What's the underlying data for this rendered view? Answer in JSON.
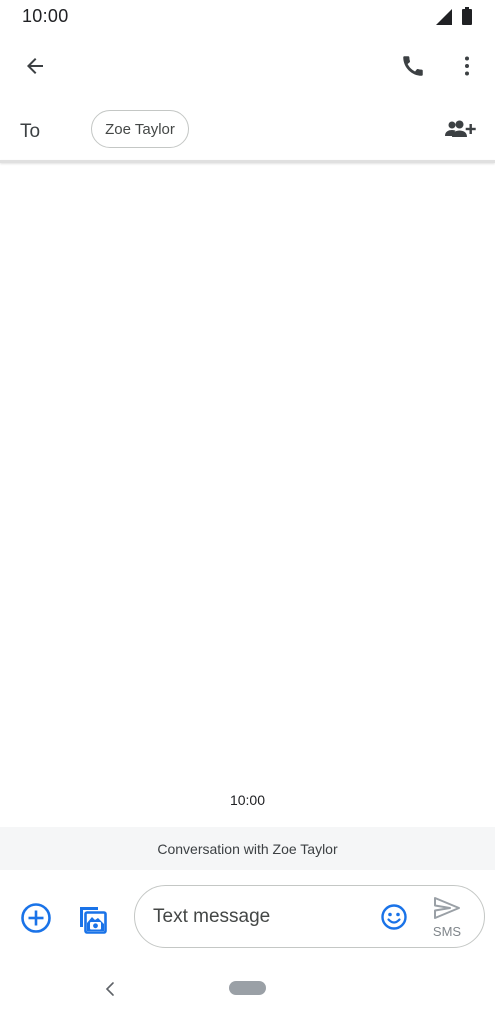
{
  "status_bar": {
    "time": "10:00",
    "icons": [
      "signal-icon",
      "battery-icon"
    ]
  },
  "app_bar": {
    "icons": [
      "back-arrow-icon",
      "phone-icon",
      "more-vert-icon"
    ]
  },
  "recipients": {
    "to_label": "To",
    "chips": [
      "Zoe Taylor"
    ],
    "add_icon": "add-person-icon"
  },
  "conversation": {
    "timestamp": "10:00",
    "banner": "Conversation with Zoe Taylor"
  },
  "compose": {
    "placeholder": "Text message",
    "value": "",
    "send_label": "SMS",
    "icons": [
      "add-circle-icon",
      "gallery-icon",
      "emoji-icon",
      "send-icon"
    ]
  },
  "nav": {
    "icons": [
      "nav-back-icon",
      "home-pill-icon"
    ]
  },
  "colors": {
    "accent": "#1a73e8",
    "icon_dark": "#3c4043",
    "banner_bg": "#f5f6f7"
  }
}
